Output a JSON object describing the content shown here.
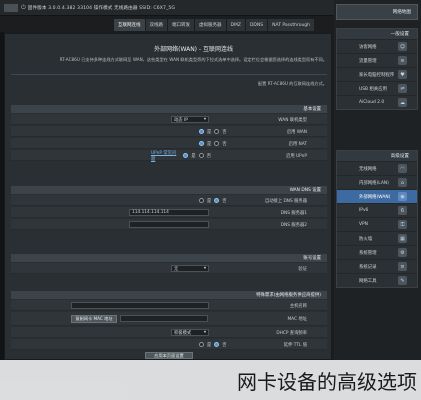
{
  "topbar": {
    "status_text": "固件版本 3.0.0.4.382 33104  操作模式 无线路由器  SSID: C6X7_5G"
  },
  "tabs": [
    {
      "label": "互联网连线"
    },
    {
      "label": "双线路"
    },
    {
      "label": "端口转发"
    },
    {
      "label": "虚拟服务器"
    },
    {
      "label": "DMZ"
    },
    {
      "label": "DDNS"
    },
    {
      "label": "NAT Passthrough"
    }
  ],
  "main": {
    "title": "外部网络(WAN) - 互联网连线",
    "intro": "RT-AC86U 已支持多种连线方式联网至 WAN，这些类型在 WAN 联机类型旁的下拉式选单中选择。设定栏位会根据您选择的连线类型而有不同。",
    "hint": "配置 RT-AC86U 的互联网连线方式。",
    "basic_section": {
      "header": "基本设置",
      "rows": [
        {
          "label": "WAN 联机类型",
          "value": "动态 IP"
        },
        {
          "label": "启用 WAN",
          "yes": "是",
          "no": "否"
        },
        {
          "label": "启用 NAT",
          "yes": "是",
          "no": "否"
        },
        {
          "label": "启用 UPnP",
          "yes": "是",
          "no": "否",
          "link": "UPnP 常见问题"
        }
      ]
    },
    "dns_section": {
      "header": "WAN DNS 设置",
      "rows": [
        {
          "label": "自动接上 DNS 服务器",
          "yes": "是",
          "no": "否"
        },
        {
          "label": "DNS 服务器1",
          "value": "114.114.114.114"
        },
        {
          "label": "DNS 服务器2",
          "value": ""
        }
      ]
    },
    "account_section": {
      "header": "账号设置",
      "rows": [
        {
          "label": "验证",
          "value": "无"
        }
      ]
    },
    "isp_section": {
      "header": "特殊需求(由网络服务供应商提供)",
      "rows": [
        {
          "label": "主机名称",
          "value": ""
        },
        {
          "label": "MAC 地址",
          "value": "",
          "button": "复制网卡 MAC 地址"
        },
        {
          "label": "DHCP 查询频率",
          "value": "积极模式"
        },
        {
          "label": "延伸 TTL 值",
          "yes": "是",
          "no": "否"
        }
      ]
    },
    "apply_label": "应用本页面设置"
  },
  "sidebar": {
    "top_item": "网络地图",
    "groups": [
      {
        "header": "一般设置",
        "items": [
          {
            "label": "访客网络",
            "icon": "guest-icon"
          },
          {
            "label": "流量管理",
            "icon": "traffic-icon"
          },
          {
            "label": "家长电脑控制程序",
            "icon": "parental-icon"
          },
          {
            "label": "USB 相关应用",
            "icon": "usb-icon"
          },
          {
            "label": "AiCloud 2.0",
            "icon": "cloud-icon"
          }
        ]
      },
      {
        "header": "高级设置",
        "items": [
          {
            "label": "无线网络",
            "icon": "wifi-icon",
            "active": false
          },
          {
            "label": "内部网络(LAN)",
            "icon": "lan-icon",
            "active": false
          },
          {
            "label": "外部网络(WAN)",
            "icon": "wan-icon",
            "active": true
          },
          {
            "label": "IPv6",
            "icon": "ipv6-icon",
            "active": false
          },
          {
            "label": "VPN",
            "icon": "vpn-icon",
            "active": false
          },
          {
            "label": "防火墙",
            "icon": "firewall-icon",
            "active": false
          },
          {
            "label": "系统管理",
            "icon": "admin-icon",
            "active": false
          },
          {
            "label": "系统记录",
            "icon": "log-icon",
            "active": false
          },
          {
            "label": "网络工具",
            "icon": "tools-icon",
            "active": false
          }
        ]
      }
    ]
  },
  "caption": "网卡设备的高级选项"
}
